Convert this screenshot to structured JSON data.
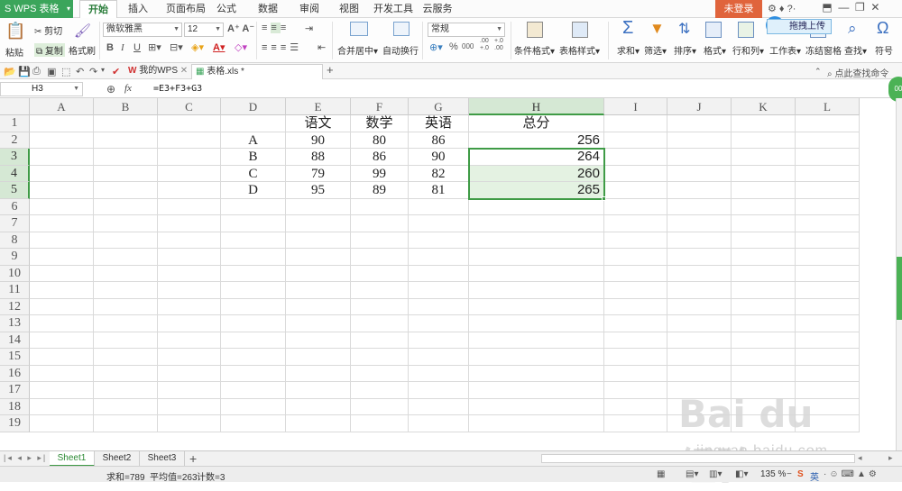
{
  "app": {
    "name": "WPS 表格"
  },
  "menu_tabs": [
    "开始",
    "插入",
    "页面布局",
    "公式",
    "数据",
    "审阅",
    "视图",
    "开发工具",
    "云服务"
  ],
  "active_tab": "开始",
  "login_label": "未登录",
  "upload_label": "拖拽上传",
  "ribbon": {
    "paste": "粘贴",
    "cut": "剪切",
    "copy": "复制",
    "format_painter": "格式刷",
    "font_name": "微软雅黑",
    "font_size": "12",
    "merge_center": "合并居中",
    "wrap_text": "自动换行",
    "number_format": "常规",
    "conditional_format": "条件格式",
    "table_style": "表格样式",
    "sum": "求和",
    "filter": "筛选",
    "sort": "排序",
    "format": "格式",
    "rows_cols": "行和列",
    "worksheet": "工作表",
    "freeze": "冻结窗格",
    "find": "查找",
    "symbol": "符号",
    "percent": "%",
    "comma": "000",
    "inc_dec": ".00 +.0",
    "dec_dec": "+.0 .00"
  },
  "quickbar": {
    "doc_tabs": [
      "我的WPS",
      "表格.xls *"
    ],
    "command_search": "点此查找命令"
  },
  "formula_bar": {
    "cell_ref": "H3",
    "fx": "fx",
    "formula": "=E3+F3+G3"
  },
  "sheet": {
    "columns": [
      "A",
      "B",
      "C",
      "D",
      "E",
      "F",
      "G",
      "H",
      "I",
      "J",
      "K",
      "L"
    ],
    "selected_column": "H",
    "rows": [
      "1",
      "2",
      "3",
      "4",
      "5",
      "6",
      "7",
      "8",
      "9",
      "10",
      "11",
      "12",
      "13",
      "14",
      "15",
      "16",
      "17",
      "18",
      "19"
    ],
    "selected_rows": [
      "3",
      "4",
      "5"
    ],
    "cells": [
      {
        "ref": "E1",
        "v": "语文"
      },
      {
        "ref": "F1",
        "v": "数学"
      },
      {
        "ref": "G1",
        "v": "英语"
      },
      {
        "ref": "H1",
        "v": "总分"
      },
      {
        "ref": "D2",
        "v": "A"
      },
      {
        "ref": "E2",
        "v": "90"
      },
      {
        "ref": "F2",
        "v": "80"
      },
      {
        "ref": "G2",
        "v": "86"
      },
      {
        "ref": "H2",
        "v": "256"
      },
      {
        "ref": "D3",
        "v": "B"
      },
      {
        "ref": "E3",
        "v": "88"
      },
      {
        "ref": "F3",
        "v": "86"
      },
      {
        "ref": "G3",
        "v": "90"
      },
      {
        "ref": "H3",
        "v": "264"
      },
      {
        "ref": "D4",
        "v": "C"
      },
      {
        "ref": "E4",
        "v": "79"
      },
      {
        "ref": "F4",
        "v": "99"
      },
      {
        "ref": "G4",
        "v": "82"
      },
      {
        "ref": "H4",
        "v": "260"
      },
      {
        "ref": "D5",
        "v": "D"
      },
      {
        "ref": "E5",
        "v": "95"
      },
      {
        "ref": "F5",
        "v": "89"
      },
      {
        "ref": "G5",
        "v": "81"
      },
      {
        "ref": "H5",
        "v": "265"
      }
    ]
  },
  "sheet_tabs": [
    "Sheet1",
    "Sheet2",
    "Sheet3"
  ],
  "active_sheet": "Sheet1",
  "status": {
    "sum": "求和=789",
    "avg": "平均值=263",
    "count": "计数=3",
    "zoom": "135 %",
    "ime": "英"
  },
  "watermark": {
    "brand": "Bai du 经验",
    "url": "jingyan.baidu.com"
  },
  "colors": {
    "accent": "#3f9b46",
    "app_green": "#3ba55b",
    "login": "#e0643c"
  }
}
